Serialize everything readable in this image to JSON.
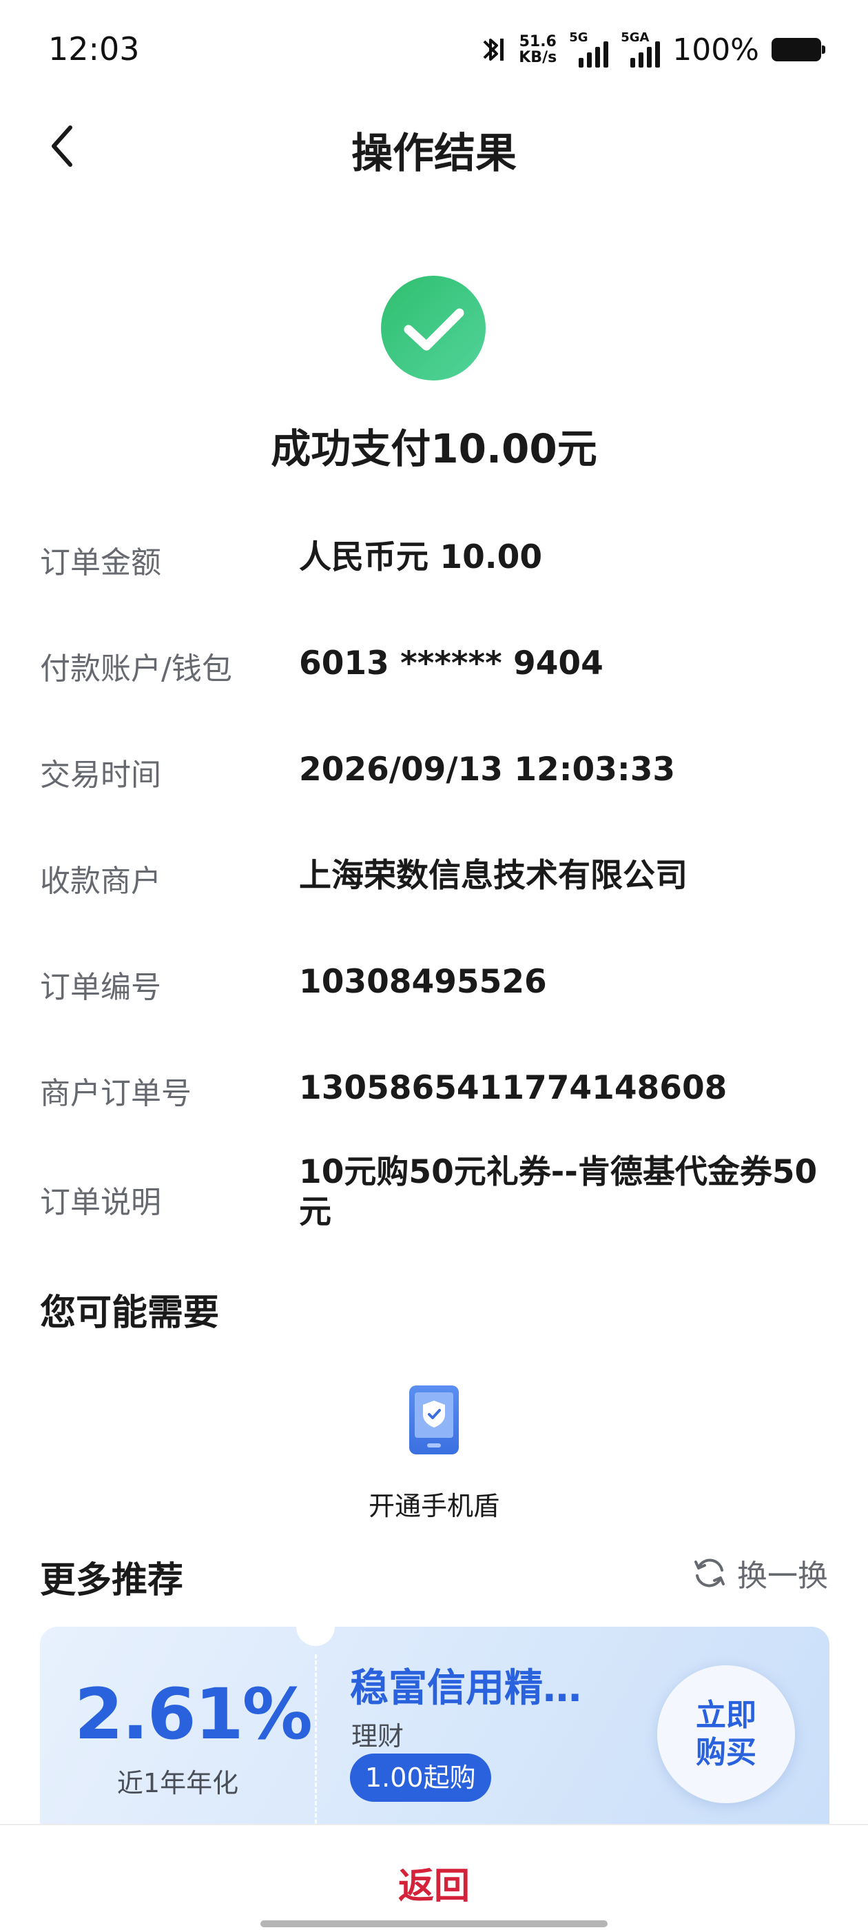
{
  "status_bar": {
    "time": "12:03",
    "net_speed_value": "51.6",
    "net_speed_unit": "KB/s",
    "sim1_label": "5G",
    "sim2_label": "5GA",
    "battery": "100%"
  },
  "nav": {
    "title": "操作结果",
    "back_icon": "chevron-left-icon"
  },
  "result": {
    "icon": "check-circle-icon",
    "message": "成功支付10.00元",
    "status_color": "#35c47a"
  },
  "details": [
    {
      "label": "订单金额",
      "value": "人民币元 10.00"
    },
    {
      "label": "付款账户/钱包",
      "value": "6013 ****** 9404"
    },
    {
      "label": "交易时间",
      "value": "2026/09/13 12:03:33"
    },
    {
      "label": "收款商户",
      "value": "上海荣数信息技术有限公司"
    },
    {
      "label": "订单编号",
      "value": "10308495526"
    },
    {
      "label": "商户订单号",
      "value": "1305865411774148608"
    },
    {
      "label": "订单说明",
      "value": "10元购50元礼券--肯德基代金券50元"
    }
  ],
  "maybe_need": {
    "title": "您可能需要",
    "item_label": "开通手机盾",
    "item_icon": "phone-shield-icon"
  },
  "recommend": {
    "title": "更多推荐",
    "refresh_label": "换一换",
    "refresh_icon": "refresh-icon"
  },
  "product": {
    "rate": "2.61%",
    "rate_label": "近1年年化",
    "name": "稳富信用精…",
    "type": "理财",
    "min_amount": "1.00起购",
    "buy_label_line1": "立即",
    "buy_label_line2": "购买",
    "accent_color": "#2a62dd"
  },
  "footer": {
    "return_label": "返回",
    "return_color": "#d4223a"
  }
}
